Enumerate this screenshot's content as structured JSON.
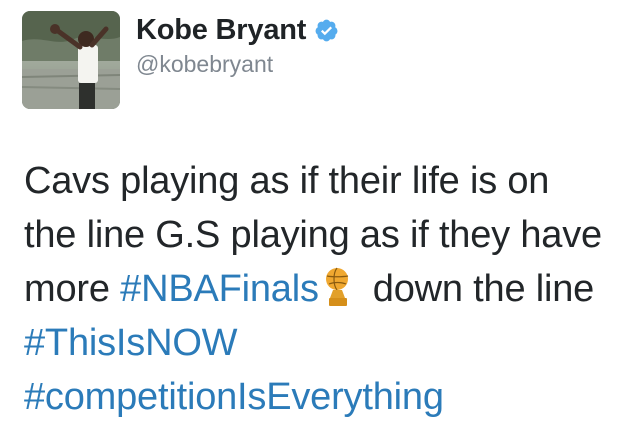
{
  "profile": {
    "display_name": "Kobe Bryant",
    "handle": "@kobebryant",
    "verified_icon": "verified-badge-icon",
    "avatar_icon": "profile-photo"
  },
  "tweet": {
    "line1": "Cavs playing as if their life is on",
    "line2": "the line G.S playing as if they have",
    "line3_before": "more ",
    "line3_hashtag": "#NBAFinals",
    "line3_after": "down the line",
    "line4_hashtag": "#ThisIsNOW",
    "line5_hashtag": "#competitionIsEverything",
    "trophy_icon": "nba-finals-trophy-icon"
  },
  "colors": {
    "hashtag": "#2b7bb9",
    "verified": "#55acee",
    "text": "#222629",
    "secondary": "#7f8790"
  }
}
